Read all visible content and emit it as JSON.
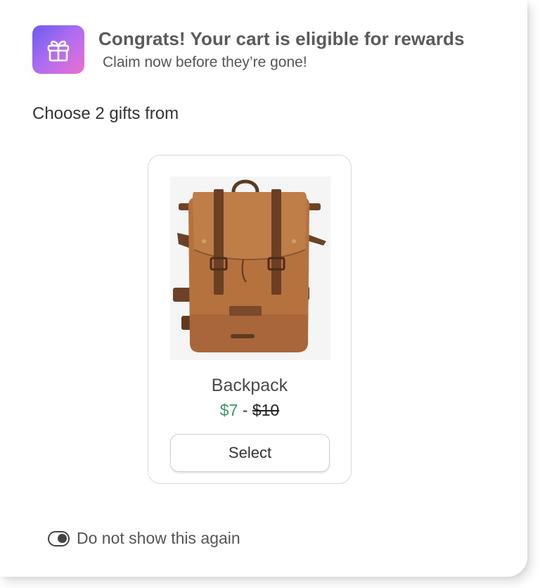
{
  "header": {
    "icon": "gift-icon",
    "badge_gradient": [
      "#6a5cf0",
      "#ee6fd0"
    ],
    "title": "Congrats! Your cart is eligible for rewards",
    "subtitle": "Claim now before they’re gone!"
  },
  "gifts": {
    "heading": "Choose 2 gifts from",
    "items": [
      {
        "image": "backpack-image",
        "name": "Backpack",
        "sale_price": "$7",
        "separator": "-",
        "original_price": "$10",
        "button_label": "Select"
      }
    ]
  },
  "footer": {
    "toggle_icon": "toggle-icon",
    "label": "Do not show this again"
  },
  "colors": {
    "sale_price": "#3b9568",
    "text": "#555555"
  }
}
